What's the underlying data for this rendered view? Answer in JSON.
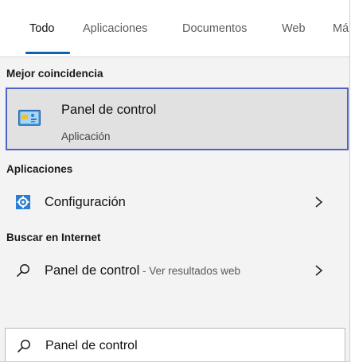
{
  "tabs": [
    {
      "label": "Todo",
      "active": true
    },
    {
      "label": "Aplicaciones",
      "active": false
    },
    {
      "label": "Documentos",
      "active": false
    },
    {
      "label": "Web",
      "active": false
    },
    {
      "label": "Má",
      "active": false
    }
  ],
  "sections": {
    "best_match": "Mejor coincidencia",
    "apps": "Aplicaciones",
    "web": "Buscar en Internet"
  },
  "best_match": {
    "title": "Panel de control",
    "subtitle": "Aplicación",
    "icon": "control-panel-icon"
  },
  "apps": [
    {
      "label": "Configuración",
      "icon": "gear-icon"
    }
  ],
  "web": [
    {
      "label": "Panel de control",
      "suffix": " - Ver resultados web",
      "icon": "search-icon"
    }
  ],
  "search": {
    "value": "Panel de control"
  },
  "colors": {
    "accent": "#0a63b7",
    "selection_border": "#4e63c4",
    "selection_bg": "#e1e1e1",
    "panel_bg": "#f3f3f3"
  }
}
